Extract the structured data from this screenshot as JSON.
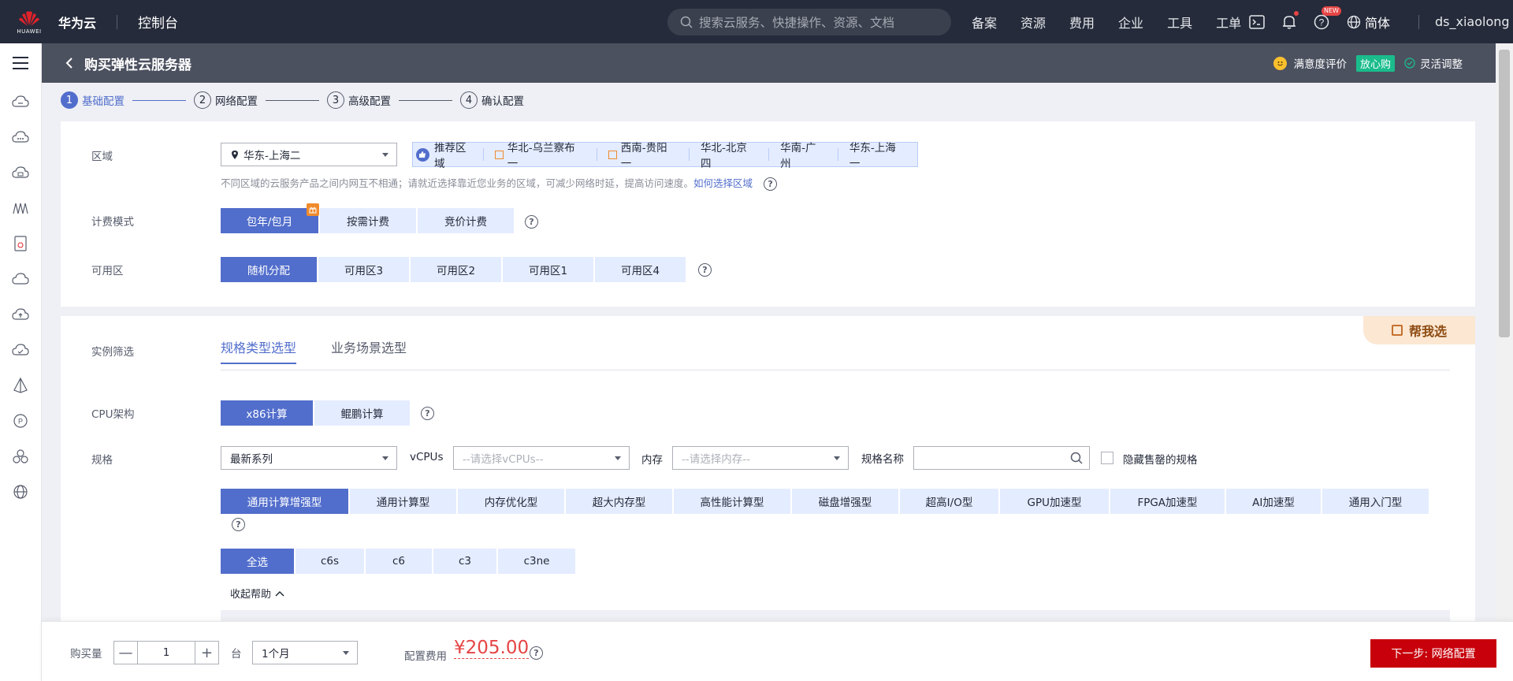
{
  "topbar": {
    "logo_text": "HUAWEI",
    "brand": "华为云",
    "console": "控制台",
    "search_placeholder": "搜索云服务、快捷操作、资源、文档",
    "nav": [
      "备案",
      "资源",
      "费用",
      "企业",
      "工具",
      "工单"
    ],
    "new_badge": "NEW",
    "lang": "简体",
    "user": "ds_xiaolong"
  },
  "subheader": {
    "title": "购买弹性云服务器",
    "satisfaction": "满意度评价",
    "assurance": "放心购",
    "flexible": "灵活调整"
  },
  "steps": [
    {
      "num": "1",
      "label": "基础配置",
      "active": true
    },
    {
      "num": "2",
      "label": "网络配置",
      "active": false
    },
    {
      "num": "3",
      "label": "高级配置",
      "active": false
    },
    {
      "num": "4",
      "label": "确认配置",
      "active": false
    }
  ],
  "region": {
    "label": "区域",
    "selected": "华东-上海二",
    "recommend_title": "推荐区域",
    "recommend": [
      "华北-乌兰察布一",
      "西南-贵阳一",
      "华北-北京四",
      "华南-广州",
      "华东-上海一"
    ],
    "hint": "不同区域的云服务产品之间内网互不相通；请就近选择靠近您业务的区域，可减少网络时延，提高访问速度。",
    "hint_link": "如何选择区域"
  },
  "billing": {
    "label": "计费模式",
    "options": [
      "包年/包月",
      "按需计费",
      "竞价计费"
    ],
    "selected_index": 0
  },
  "az": {
    "label": "可用区",
    "options": [
      "随机分配",
      "可用区3",
      "可用区2",
      "可用区1",
      "可用区4"
    ],
    "selected_index": 0
  },
  "instance": {
    "label": "实例筛选",
    "tabs": [
      "规格类型选型",
      "业务场景选型"
    ],
    "help_me": "帮我选"
  },
  "cpu": {
    "label": "CPU架构",
    "options": [
      "x86计算",
      "鲲鹏计算"
    ],
    "selected_index": 0
  },
  "spec": {
    "label": "规格",
    "series": "最新系列",
    "vcpus_label": "vCPUs",
    "vcpus_placeholder": "--请选择vCPUs--",
    "mem_label": "内存",
    "mem_placeholder": "--请选择内存--",
    "name_label": "规格名称",
    "hide_soldout": "隐藏售罄的规格",
    "types": [
      "通用计算增强型",
      "通用计算型",
      "内存优化型",
      "超大内存型",
      "高性能计算型",
      "磁盘增强型",
      "超高I/O型",
      "GPU加速型",
      "FPGA加速型",
      "AI加速型",
      "通用入门型"
    ],
    "sub_types": [
      "全选",
      "c6s",
      "c6",
      "c3",
      "c3ne"
    ],
    "collapse_help": "收起帮助"
  },
  "bottom": {
    "qty_label": "购买量",
    "qty": "1",
    "unit": "台",
    "duration": "1个月",
    "fee_label": "配置费用",
    "price": "¥205.00",
    "next": "下一步: 网络配置"
  }
}
